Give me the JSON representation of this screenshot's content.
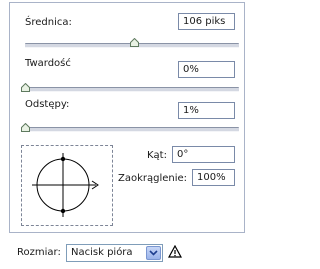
{
  "brush": {
    "diameter": {
      "label": "Średnica:",
      "value": "106 piks",
      "slider_fraction": 0.5
    },
    "hardness": {
      "label": "Twardość",
      "value": "0%",
      "slider_fraction": 0.0
    },
    "spacing": {
      "label": "Odstępy:",
      "value": "1%",
      "slider_fraction": 0.0
    },
    "angle": {
      "label": "Kąt:",
      "value": "0°"
    },
    "roundness": {
      "label": "Zaokrąglenie:",
      "value": "100%"
    }
  },
  "footer": {
    "size_label": "Rozmiar:",
    "size_select": {
      "selected": "Nacisk pióra"
    }
  },
  "icons": {
    "dropdown": "chevron-down-icon",
    "warning": "warning-icon"
  },
  "colors": {
    "field_border": "#7a8aa8",
    "slider_thumb": "#e9f2e4",
    "warning": "#000000"
  }
}
